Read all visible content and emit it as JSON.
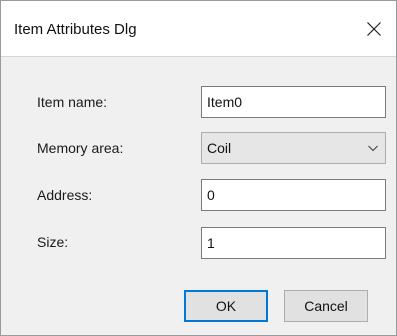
{
  "dialog": {
    "title": "Item Attributes Dlg",
    "close_icon": "close-icon"
  },
  "form": {
    "item_name_label": "Item name:",
    "item_name_value": "Item0",
    "memory_area_label": "Memory area:",
    "memory_area_value": "Coil",
    "address_label": "Address:",
    "address_value": "0",
    "size_label": "Size:",
    "size_value": "1"
  },
  "buttons": {
    "ok_label": "OK",
    "cancel_label": "Cancel"
  },
  "colors": {
    "accent": "#0078d7",
    "dialog_bg": "#f0f0f0",
    "titlebar_bg": "#ffffff"
  }
}
